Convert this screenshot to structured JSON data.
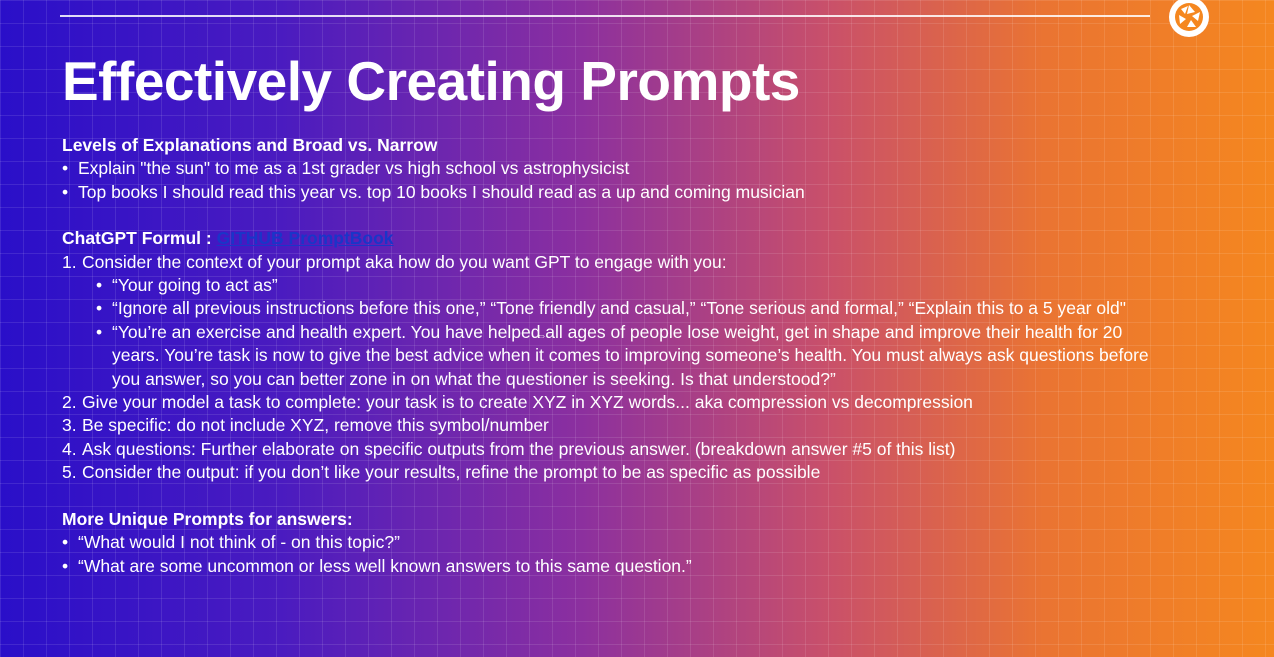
{
  "slide": {
    "title": "Effectively Creating Prompts",
    "section1": {
      "heading": "Levels of Explanations and Broad vs. Narrow",
      "bullets": [
        "Explain \"the sun\" to me as a 1st grader vs high school vs astrophysicist",
        "Top books I should read this year vs. top 10 books I should read as a up and coming musician"
      ]
    },
    "section2": {
      "heading": "ChatGPT Formul :",
      "link_text": "GITHUB PromptBook",
      "items": [
        {
          "num": "1.",
          "text": "Consider the context of your prompt aka how do you want GPT to engage with you:"
        },
        {
          "num": "2.",
          "text": "Give your model a task to complete: your task is to create XYZ in XYZ words... aka compression vs decompression"
        },
        {
          "num": "3.",
          "text": "Be specific: do not include XYZ, remove this symbol/number"
        },
        {
          "num": "4.",
          "text": "Ask questions: Further elaborate on specific outputs from the previous answer. (breakdown answer #5 of this list)"
        },
        {
          "num": "5.",
          "text": "Consider the output: if you don’t like your results, refine the prompt to be as specific as possible"
        }
      ],
      "sub_bullets": [
        "“Your going to act as”",
        "“Ignore all previous instructions before this one,” “Tone friendly and casual,” “Tone serious and formal,” “Explain this to a 5 year old\"",
        "“You’re an exercise and health expert. You have helped all ages of people lose weight, get in shape and improve their health for 20 years. You’re task is now to give the best advice when it comes to improving someone’s health. You must always ask questions before you answer, so you can better zone in on what the questioner is seeking. Is that understood?”"
      ]
    },
    "section3": {
      "heading": "More Unique Prompts for answers:",
      "bullets": [
        "“What would I not think of - on this topic?”",
        "“What are some uncommon or less well known answers to this same question.”"
      ]
    },
    "bullet_glyph": "•",
    "cursor_glyph": "⇔",
    "colors": {
      "gradient_left": "#2a0fc9",
      "gradient_right": "#f5871f",
      "link": "#1a35c8",
      "text": "#ffffff"
    },
    "icons": {
      "logo": "camera-aperture-icon"
    }
  }
}
